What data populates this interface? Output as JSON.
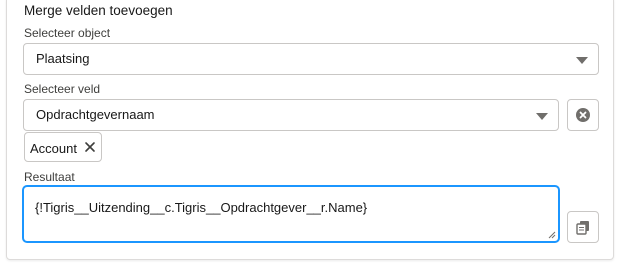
{
  "title": "Merge velden toevoegen",
  "object_section": {
    "label": "Selecteer object",
    "selected": "Plaatsing"
  },
  "field_section": {
    "label": "Selecteer veld",
    "selected": "Opdrachtgevernaam",
    "clear_icon": "circle-x-icon",
    "pill": {
      "label": "Account",
      "remove_icon": "close-icon"
    }
  },
  "result_section": {
    "label": "Resultaat",
    "value": "{!Tigris__Uitzending__c.Tigris__Opdrachtgever__r.Name}",
    "copy_icon": "copy-icon"
  },
  "colors": {
    "focus_border": "#1b96ff",
    "border": "#c9c7c5",
    "icon": "#706e6b"
  }
}
